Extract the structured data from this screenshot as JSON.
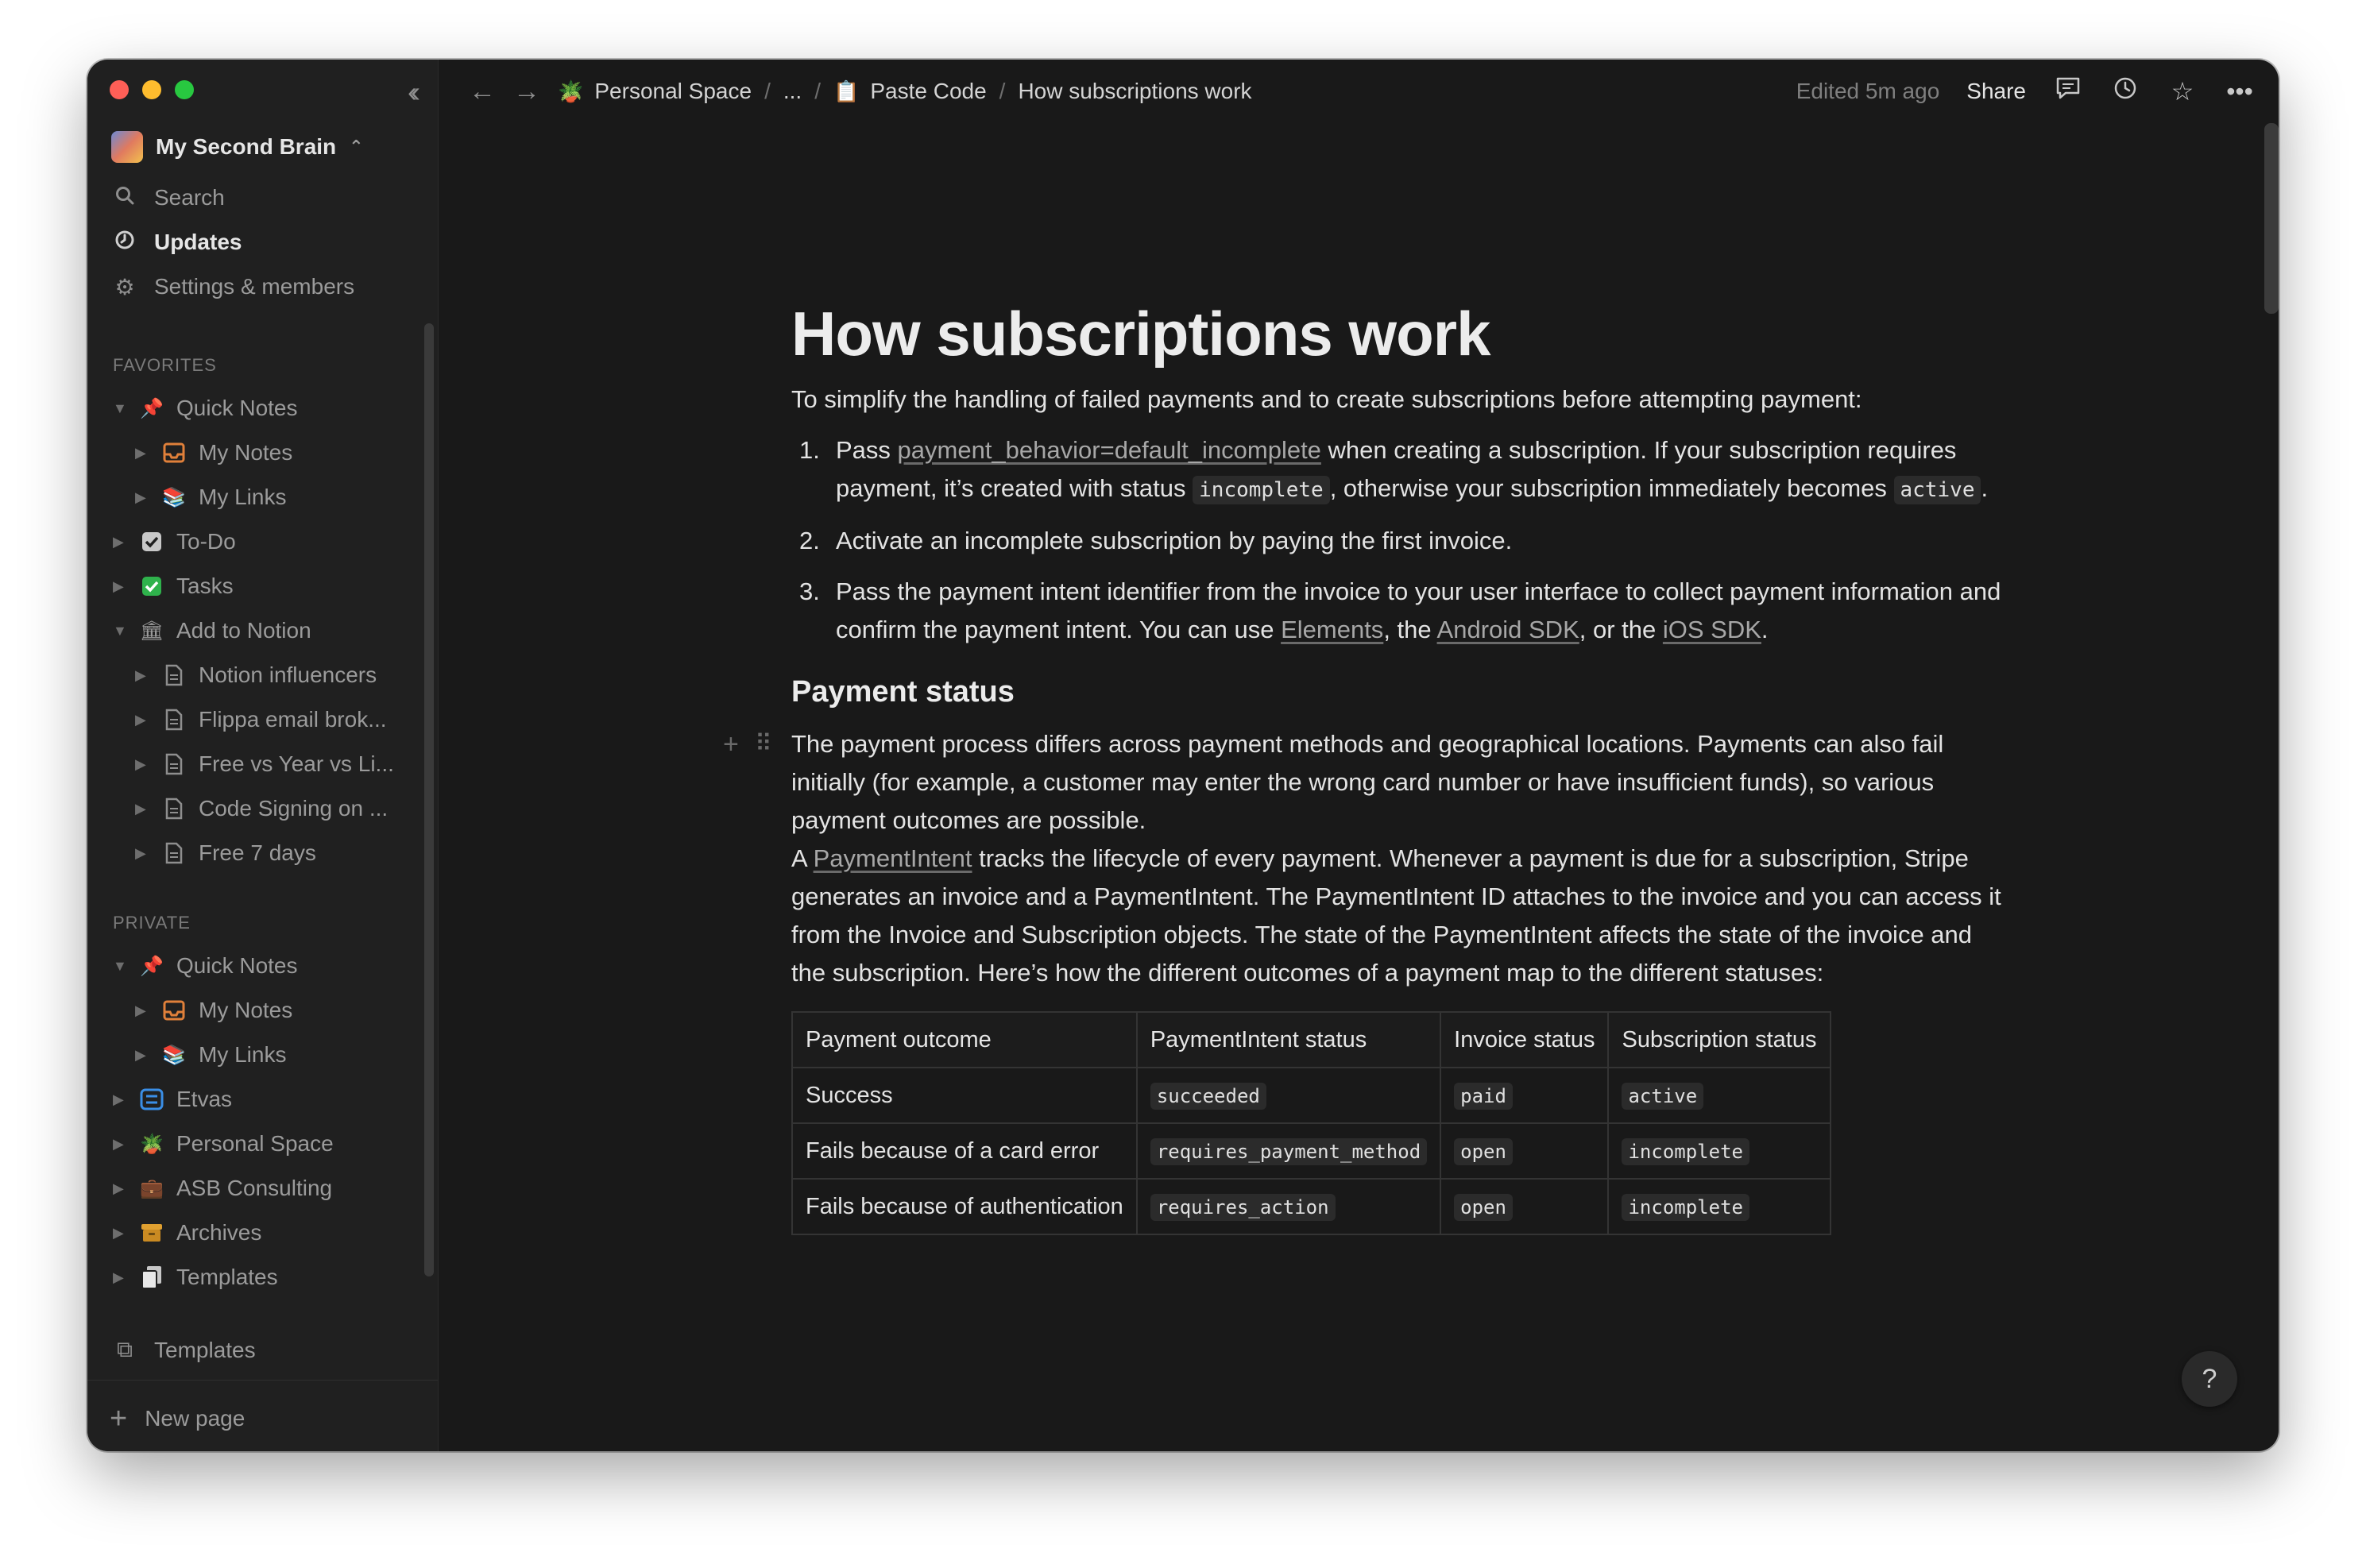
{
  "sidebar": {
    "workspace_name": "My Second Brain",
    "top_items": [
      {
        "label": "Search",
        "icon": "search-icon"
      },
      {
        "label": "Updates",
        "icon": "clock-icon"
      },
      {
        "label": "Settings & members",
        "icon": "gear-icon"
      }
    ],
    "favorites_label": "FAVORITES",
    "favorites": [
      {
        "label": "Quick Notes",
        "icon": "pushpin-icon",
        "expanded": true
      },
      {
        "label": "My Notes",
        "icon": "inbox-icon",
        "indent": 1
      },
      {
        "label": "My Links",
        "icon": "books-icon",
        "indent": 1
      },
      {
        "label": "To-Do",
        "icon": "checkbox-icon"
      },
      {
        "label": "Tasks",
        "icon": "green-check-icon"
      },
      {
        "label": "Add to Notion",
        "icon": "building-icon",
        "expanded": true
      },
      {
        "label": "Notion influencers",
        "icon": "page-icon",
        "indent": 1
      },
      {
        "label": "Flippa email brok...",
        "icon": "page-icon",
        "indent": 1
      },
      {
        "label": "Free vs Year vs Li...",
        "icon": "page-icon",
        "indent": 1
      },
      {
        "label": "Code Signing on ...",
        "icon": "page-icon",
        "indent": 1
      },
      {
        "label": "Free 7 days",
        "icon": "page-icon",
        "indent": 1
      }
    ],
    "private_label": "PRIVATE",
    "private": [
      {
        "label": "Quick Notes",
        "icon": "pushpin-icon",
        "expanded": true
      },
      {
        "label": "My Notes",
        "icon": "inbox-icon",
        "indent": 1
      },
      {
        "label": "My Links",
        "icon": "books-icon",
        "indent": 1
      },
      {
        "label": "Etvas",
        "icon": "list-icon"
      },
      {
        "label": "Personal Space",
        "icon": "plant-icon"
      },
      {
        "label": "ASB Consulting",
        "icon": "briefcase-icon"
      },
      {
        "label": "Archives",
        "icon": "archive-box-icon"
      },
      {
        "label": "Templates",
        "icon": "documents-icon"
      }
    ],
    "templates_label": "Templates",
    "new_page_label": "New page"
  },
  "topbar": {
    "breadcrumbs": [
      "Personal Space",
      "...",
      "Paste Code",
      "How subscriptions work"
    ],
    "edited": "Edited 5m ago",
    "share": "Share"
  },
  "page": {
    "title": "How subscriptions work",
    "intro": "To simplify the handling of failed payments and to create subscriptions before attempting payment:",
    "steps": {
      "s1": {
        "num": "1.",
        "pre": "Pass ",
        "link": "payment_behavior=default_incomplete",
        "mid": " when creating a subscription. If your subscription requires payment, it’s created with status ",
        "code1": "incomplete",
        "mid2": ", otherwise your subscription immediately becomes ",
        "code2": "active",
        "post": "."
      },
      "s2": {
        "num": "2.",
        "text": "Activate an incomplete subscription by paying the first invoice."
      },
      "s3": {
        "num": "3.",
        "pre": "Pass the payment intent identifier from the invoice to your user interface to collect payment information and confirm the payment intent. You can use ",
        "link1": "Elements",
        "mid1": ", the ",
        "link2": "Android SDK",
        "mid2": ", or the ",
        "link3": "iOS SDK",
        "post": "."
      }
    },
    "heading2": "Payment status",
    "para1": "The payment process differs across payment methods and geographical locations. Payments can also fail initially (for example, a customer may enter the wrong card number or have insufficient funds), so various payment outcomes are possible.",
    "para2_pre": "A ",
    "para2_link": "PaymentIntent",
    "para2_post": " tracks the lifecycle of every payment. Whenever a payment is due for a subscription, Stripe generates an invoice and a PaymentIntent. The PaymentIntent ID attaches to the invoice and you can access it from the Invoice and Subscription objects. The state of the PaymentIntent affects the state of the invoice and the subscription. Here’s how the different outcomes of a payment map to the different statuses:",
    "table": {
      "headers": [
        "Payment outcome",
        "PaymentIntent status",
        "Invoice status",
        "Subscription status"
      ],
      "rows": [
        [
          "Success",
          "succeeded",
          "paid",
          "active"
        ],
        [
          "Fails because of a card error",
          "requires_payment_method",
          "open",
          "incomplete"
        ],
        [
          "Fails because of authentication",
          "requires_action",
          "open",
          "incomplete"
        ]
      ]
    }
  },
  "help_label": "?",
  "colors": {
    "window_bg": "#191919",
    "sidebar_bg": "#202020",
    "text": "#e3e3e3",
    "muted": "#9b9b9b"
  }
}
